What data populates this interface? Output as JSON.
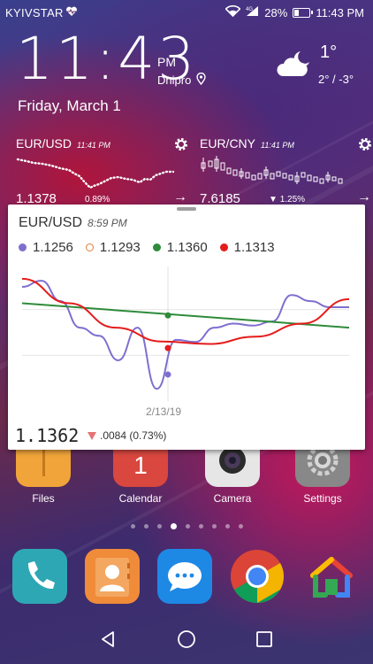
{
  "status": {
    "carrier": "KYIVSTAR",
    "battery": "28%",
    "battery_level": 0.28,
    "time": "11:43 PM"
  },
  "clock": {
    "time": "11:43",
    "ampm": "PM",
    "city": "Dnipro",
    "date": "Friday, March 1",
    "temperature": "1°",
    "range": "2° / -3°"
  },
  "widgets": [
    {
      "pair": "EUR/USD",
      "time": "11:41 PM",
      "value": "1.1378",
      "change": "0.89%"
    },
    {
      "pair": "EUR/CNY",
      "time": "11:41 PM",
      "value": "7.6185",
      "change": "1.25%"
    }
  ],
  "card": {
    "title": "EUR/USD",
    "time": "8:59 PM",
    "legend": [
      {
        "value": "1.1256",
        "color": "#7e6fcf"
      },
      {
        "value": "1.1293",
        "color": "#e07b39"
      },
      {
        "value": "1.1360",
        "color": "#2e8b3a"
      },
      {
        "value": "1.1313",
        "color": "#e51c1c"
      }
    ],
    "x_label": "2/13/19",
    "current": "1.1362",
    "change": ".0084 (0.73%)"
  },
  "chart_data": {
    "type": "line",
    "title": "EUR/USD",
    "series": [
      {
        "name": "1.1256",
        "values": [
          1.143,
          1.1445,
          1.1395,
          1.133,
          1.131,
          1.125,
          1.133,
          1.118,
          1.13,
          1.1295,
          1.133,
          1.134,
          1.1335,
          1.1345,
          1.141,
          1.1395,
          1.138,
          1.138
        ]
      },
      {
        "name": "1.1360",
        "values": [
          1.139,
          1.1378,
          1.1366,
          1.1354,
          1.1342,
          1.133
        ]
      },
      {
        "name": "1.1313",
        "values": [
          1.145,
          1.139,
          1.133,
          1.1296,
          1.129,
          1.1308,
          1.134,
          1.14
        ]
      }
    ],
    "highlight": {
      "label": "2/13/19",
      "values": {
        "green": 1.136,
        "red": 1.128,
        "purple": 1.1215
      }
    },
    "ylim": [
      1.115,
      1.148
    ],
    "grid": true
  },
  "dock_row1": [
    {
      "label": "Files",
      "color": "#f0a43a"
    },
    {
      "label": "Calendar",
      "color": "#d9473f",
      "number": "1"
    },
    {
      "label": "Camera",
      "color": "#e6e6e6"
    },
    {
      "label": "Settings",
      "color": "#888888"
    }
  ],
  "dock_row2": [
    {
      "name": "phone-app",
      "color": "#2ea7b5"
    },
    {
      "name": "contacts-app",
      "color": "#f08b3a"
    },
    {
      "name": "messages-app",
      "color": "#1e88e5"
    },
    {
      "name": "chrome-app",
      "color": "#ffffff"
    },
    {
      "name": "google-home-app",
      "color": "#ffffff"
    }
  ],
  "pager": {
    "count": 9,
    "active": 3
  }
}
